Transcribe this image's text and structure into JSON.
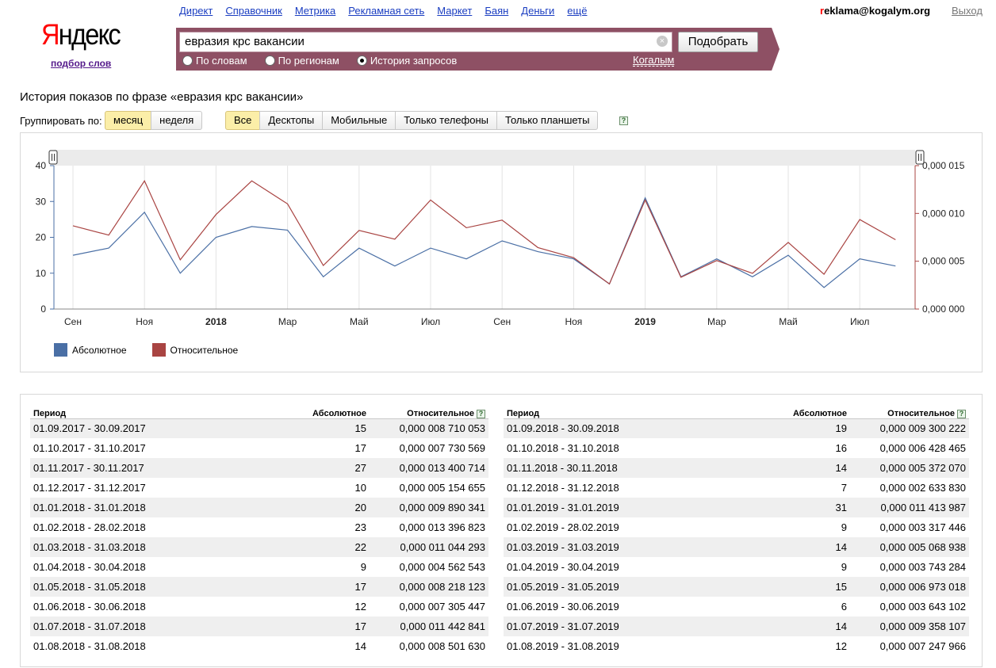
{
  "header": {
    "logo": "Яндекс",
    "logo_subtitle": "подбор слов",
    "nav": [
      "Директ",
      "Справочник",
      "Метрика",
      "Рекламная сеть",
      "Маркет",
      "Баян",
      "Деньги",
      "ещё"
    ],
    "user": "reklama@kogalym.org",
    "logout": "Выход"
  },
  "search": {
    "query": "евразия крс вакансии",
    "submit": "Подобрать",
    "clear_icon": "clear-circle-icon",
    "modes": [
      {
        "label": "По словам",
        "selected": false
      },
      {
        "label": "По регионам",
        "selected": false
      },
      {
        "label": "История запросов",
        "selected": true
      }
    ],
    "region": "Когалым",
    "bar_color": "#8e5064"
  },
  "page": {
    "title": "История показов по фразе «евразия крс вакансии»",
    "group_label": "Группировать по:",
    "group_options": [
      {
        "label": "месяц",
        "active": true
      },
      {
        "label": "неделя",
        "active": false
      }
    ],
    "device_options": [
      {
        "label": "Все",
        "active": true
      },
      {
        "label": "Десктопы",
        "active": false
      },
      {
        "label": "Мобильные",
        "active": false
      },
      {
        "label": "Только телефоны",
        "active": false
      },
      {
        "label": "Только планшеты",
        "active": false
      }
    ],
    "help_icon": "help-question-icon"
  },
  "chart_data": {
    "type": "line",
    "x_tick_labels": [
      "Сен",
      "Ноя",
      "2018",
      "Мар",
      "Май",
      "Июл",
      "Сен",
      "Ноя",
      "2019",
      "Мар",
      "Май",
      "Июл"
    ],
    "x_tick_bold": [
      false,
      false,
      true,
      false,
      false,
      false,
      false,
      false,
      true,
      false,
      false,
      false
    ],
    "y_left_ticks": [
      "0",
      "10",
      "20",
      "30",
      "40"
    ],
    "y_left_lim": [
      0,
      40
    ],
    "y_right_ticks": [
      "0,000 000",
      "0,000 005",
      "0,000 010",
      "0,000 015"
    ],
    "y_right_lim": [
      0,
      1.5e-05
    ],
    "grid": true,
    "legend_placement": "bottom-left",
    "series": [
      {
        "name": "Абсолютное",
        "axis": "left",
        "color": "#4a6fa5",
        "values": [
          15,
          17,
          27,
          10,
          20,
          23,
          22,
          9,
          17,
          12,
          17,
          14,
          19,
          16,
          14,
          7,
          31,
          9,
          14,
          9,
          15,
          6,
          14,
          12
        ]
      },
      {
        "name": "Относительное",
        "axis": "right",
        "color": "#a94442",
        "values": [
          8.71e-06,
          7.73e-06,
          1.34e-05,
          5.15e-06,
          9.89e-06,
          1.34e-05,
          1.1e-05,
          4.56e-06,
          8.22e-06,
          7.31e-06,
          1.14e-05,
          8.5e-06,
          9.3e-06,
          6.43e-06,
          5.37e-06,
          2.63e-06,
          1.14e-05,
          3.32e-06,
          5.07e-06,
          3.74e-06,
          6.97e-06,
          3.64e-06,
          9.36e-06,
          7.25e-06
        ]
      }
    ]
  },
  "table": {
    "headers": {
      "period": "Период",
      "abs": "Абсолютное",
      "rel": "Относительное"
    },
    "left_rows": [
      [
        "01.09.2017 - 30.09.2017",
        "15",
        "0,000 008 710 053"
      ],
      [
        "01.10.2017 - 31.10.2017",
        "17",
        "0,000 007 730 569"
      ],
      [
        "01.11.2017 - 30.11.2017",
        "27",
        "0,000 013 400 714"
      ],
      [
        "01.12.2017 - 31.12.2017",
        "10",
        "0,000 005 154 655"
      ],
      [
        "01.01.2018 - 31.01.2018",
        "20",
        "0,000 009 890 341"
      ],
      [
        "01.02.2018 - 28.02.2018",
        "23",
        "0,000 013 396 823"
      ],
      [
        "01.03.2018 - 31.03.2018",
        "22",
        "0,000 011 044 293"
      ],
      [
        "01.04.2018 - 30.04.2018",
        "9",
        "0,000 004 562 543"
      ],
      [
        "01.05.2018 - 31.05.2018",
        "17",
        "0,000 008 218 123"
      ],
      [
        "01.06.2018 - 30.06.2018",
        "12",
        "0,000 007 305 447"
      ],
      [
        "01.07.2018 - 31.07.2018",
        "17",
        "0,000 011 442 841"
      ],
      [
        "01.08.2018 - 31.08.2018",
        "14",
        "0,000 008 501 630"
      ]
    ],
    "right_rows": [
      [
        "01.09.2018 - 30.09.2018",
        "19",
        "0,000 009 300 222"
      ],
      [
        "01.10.2018 - 31.10.2018",
        "16",
        "0,000 006 428 465"
      ],
      [
        "01.11.2018 - 30.11.2018",
        "14",
        "0,000 005 372 070"
      ],
      [
        "01.12.2018 - 31.12.2018",
        "7",
        "0,000 002 633 830"
      ],
      [
        "01.01.2019 - 31.01.2019",
        "31",
        "0,000 011 413 987"
      ],
      [
        "01.02.2019 - 28.02.2019",
        "9",
        "0,000 003 317 446"
      ],
      [
        "01.03.2019 - 31.03.2019",
        "14",
        "0,000 005 068 938"
      ],
      [
        "01.04.2019 - 30.04.2019",
        "9",
        "0,000 003 743 284"
      ],
      [
        "01.05.2019 - 31.05.2019",
        "15",
        "0,000 006 973 018"
      ],
      [
        "01.06.2019 - 30.06.2019",
        "6",
        "0,000 003 643 102"
      ],
      [
        "01.07.2019 - 31.07.2019",
        "14",
        "0,000 009 358 107"
      ],
      [
        "01.08.2019 - 31.08.2019",
        "12",
        "0,000 007 247 966"
      ]
    ]
  }
}
